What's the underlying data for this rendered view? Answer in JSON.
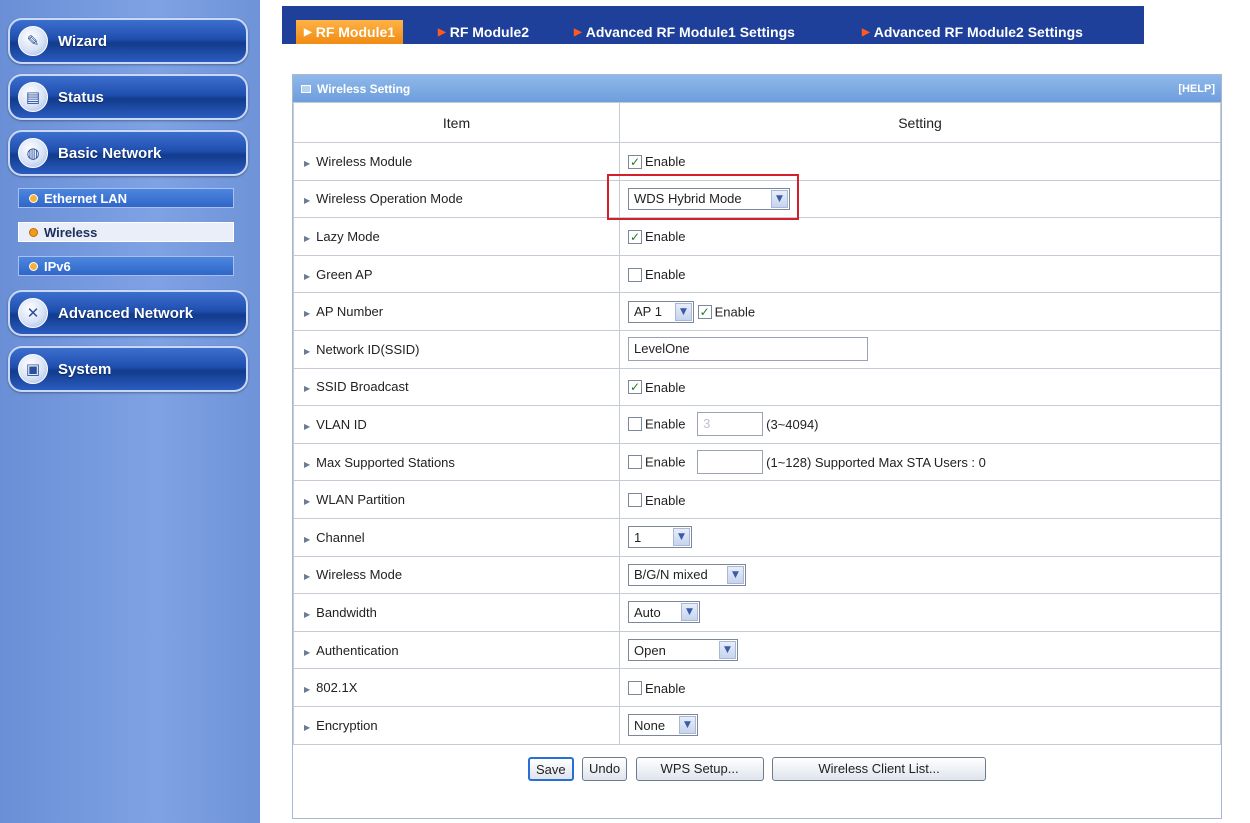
{
  "sidebar": {
    "buttons": [
      {
        "label": "Wizard",
        "icon": "wizard-icon",
        "glyph": "✎"
      },
      {
        "label": "Status",
        "icon": "status-icon",
        "glyph": "▤"
      },
      {
        "label": "Basic Network",
        "icon": "globe-icon",
        "glyph": "◍"
      },
      {
        "label": "Advanced Network",
        "icon": "tools-icon",
        "glyph": "✕"
      },
      {
        "label": "System",
        "icon": "system-icon",
        "glyph": "▣"
      }
    ],
    "sub_items": [
      {
        "label": "Ethernet LAN",
        "active": false
      },
      {
        "label": "Wireless",
        "active": true
      },
      {
        "label": "IPv6",
        "active": false
      }
    ]
  },
  "tabs": [
    {
      "label": "RF Module1",
      "active": true
    },
    {
      "label": "RF Module2",
      "active": false
    },
    {
      "label": "Advanced RF Module1 Settings",
      "active": false
    },
    {
      "label": "Advanced RF Module2 Settings",
      "active": false
    }
  ],
  "panel": {
    "title": "Wireless Setting",
    "help": "[HELP]",
    "col_item": "Item",
    "col_setting": "Setting"
  },
  "rows": {
    "wireless_module": {
      "label": "Wireless Module",
      "checked": "✓",
      "enable": "Enable"
    },
    "operation_mode": {
      "label": "Wireless Operation Mode",
      "value": "WDS Hybrid Mode"
    },
    "lazy_mode": {
      "label": "Lazy Mode",
      "checked": "✓",
      "enable": "Enable"
    },
    "green_ap": {
      "label": "Green AP",
      "checked": "",
      "enable": "Enable"
    },
    "ap_number": {
      "label": "AP Number",
      "value": "AP 1",
      "checked": "✓",
      "enable": "Enable"
    },
    "ssid": {
      "label": "Network ID(SSID)",
      "value": "LevelOne"
    },
    "ssid_broadcast": {
      "label": "SSID Broadcast",
      "checked": "✓",
      "enable": "Enable"
    },
    "vlan_id": {
      "label": "VLAN ID",
      "checked": "",
      "enable": "Enable",
      "value": "3",
      "range": "(3~4094)"
    },
    "max_stations": {
      "label": "Max Supported Stations",
      "checked": "",
      "enable": "Enable",
      "value": "",
      "note": "(1~128) Supported Max STA Users : 0"
    },
    "wlan_partition": {
      "label": "WLAN Partition",
      "checked": "",
      "enable": "Enable"
    },
    "channel": {
      "label": "Channel",
      "value": "1"
    },
    "wireless_mode": {
      "label": "Wireless Mode",
      "value": "B/G/N mixed"
    },
    "bandwidth": {
      "label": "Bandwidth",
      "value": "Auto"
    },
    "authentication": {
      "label": "Authentication",
      "value": "Open"
    },
    "dot1x": {
      "label": "802.1X",
      "checked": "",
      "enable": "Enable"
    },
    "encryption": {
      "label": "Encryption",
      "value": "None"
    }
  },
  "actions": {
    "save": "Save",
    "undo": "Undo",
    "wps": "WPS Setup...",
    "client_list": "Wireless Client List..."
  },
  "colors": {
    "sidebar_bg": "#7fa2e4",
    "tabbar_bg": "#1e3f9a",
    "active_tab": "#f08a12",
    "panel_header": "#7aaae2",
    "highlight": "#d3202b"
  }
}
